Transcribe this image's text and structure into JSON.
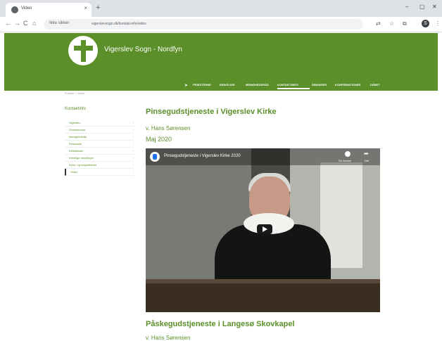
{
  "browser": {
    "tab_title": "Video",
    "tab_close": "×",
    "new_tab": "+",
    "window_controls": [
      "–",
      "▢",
      "✕"
    ],
    "nav": [
      "←",
      "→",
      "C",
      "⌂"
    ],
    "info_label": "Ikke sikker",
    "url": "vigerslevsogn.dk/kontakt-info/video",
    "profile_initial": "S",
    "icons": [
      "translate-icon",
      "star-icon",
      "extensions-icon",
      "profile-icon",
      "menu-icon"
    ]
  },
  "site": {
    "title": "Vigerslev Sogn - Nordfyn",
    "brand_color": "#5a8f29",
    "nav_items": [
      "PRÆSTERNE",
      "KIRKELIGE",
      "MENIGHEDSRÅD",
      "KONTAKT/INFO",
      "ÅBNINGER",
      "KONFIRMATIONER",
      "DÅBET"
    ],
    "breadcrumb": "Forside > Video"
  },
  "sidebar": {
    "title": "Kontaktinfo",
    "items": [
      {
        "label": "Vigerslev",
        "active": false
      },
      {
        "label": "Graverkontor",
        "active": false
      },
      {
        "label": "Menighedsråd",
        "active": false
      },
      {
        "label": "Personale",
        "active": false
      },
      {
        "label": "Kirkebladet",
        "active": false
      },
      {
        "label": "Kirkelige handlinger",
        "active": false
      },
      {
        "label": "Kirke- og sognebladet",
        "active": false
      },
      {
        "label": "Video",
        "active": true
      }
    ]
  },
  "main": {
    "title": "Pinsegudstjeneste i Vigerslev Kirke",
    "byline": "v. Hans Sørensen",
    "date": "Maj 2020",
    "video": {
      "title": "Pinsegudstjeneste i Vigerslev Kirke 2020",
      "watch_later": "Se senere",
      "share": "Del"
    },
    "next_title": "Påskegudstjeneste i Langesø Skovkapel",
    "next_byline": "v. Hans Sørensen"
  }
}
